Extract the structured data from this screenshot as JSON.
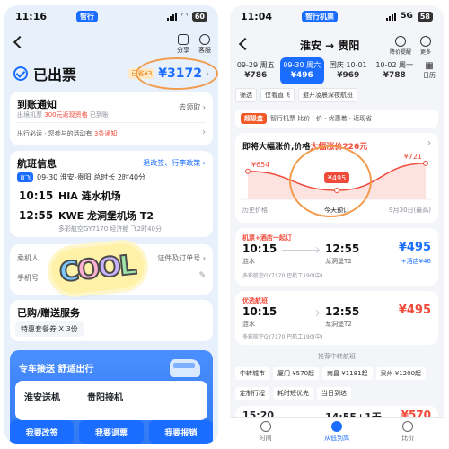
{
  "left": {
    "status": {
      "time": "11:16",
      "pill": "智行",
      "battery": "60"
    },
    "toolbar": {
      "share": "分享",
      "service": "客服"
    },
    "issued": {
      "label": "已出票",
      "saved": "已省¥3",
      "price": "¥3172"
    },
    "arrival": {
      "title": "到账通知",
      "desc_prefix": "出境机票",
      "desc_red": "300元返现资格",
      "desc_suffix": "已到账",
      "action": "去领取",
      "activity_prefix": "出行必读 · 您参与的活动有",
      "activity_red": "3条通知"
    },
    "flight": {
      "title": "航班信息",
      "links": "退改签、行李政策",
      "tag": "直飞",
      "summary": "09-30 淮安-贵阳 总时长 2时40分",
      "dep_time": "10:15",
      "dep_airport": "HIA 涟水机场",
      "arr_time": "12:55",
      "arr_airport": "KWE 龙洞堡机场 T2",
      "meta": "多彩航空GY7170  经济舱  飞2时40分"
    },
    "passenger": {
      "label1": "乘机人",
      "label2": "手机号",
      "doc": "证件及订单号"
    },
    "sticker": {
      "letters": [
        "C",
        "O",
        "O",
        "L"
      ]
    },
    "purchase": {
      "title": "已购/赠送服务",
      "chip": "特惠套餐券 X 3份"
    },
    "banner": {
      "title": "专车接送 舒适出行"
    },
    "transfer": {
      "left": "淮安送机",
      "right": "贵阳接机"
    },
    "actions": [
      "我要改签",
      "我要退票",
      "我要报销"
    ]
  },
  "right": {
    "status": {
      "time": "11:04",
      "pill": "智行机票",
      "battery": "58"
    },
    "header": {
      "route": "淮安 → 贵阳",
      "tool1": "降价提醒",
      "tool2": "更多"
    },
    "dates": [
      {
        "d": "09-29 周五",
        "p": "¥786",
        "active": false
      },
      {
        "d": "09-30 周六",
        "p": "¥496",
        "active": true
      },
      {
        "d": "国庆 10-01",
        "p": "¥969",
        "active": false
      },
      {
        "d": "10-02 周一",
        "p": "¥788",
        "active": false
      }
    ],
    "calendar": "日历",
    "filters": [
      "筛选",
      "仅看直飞",
      "避开凌晨深夜航班"
    ],
    "promo": {
      "logo": "超级盒",
      "text": "智行机票 比价 · 价 · 优惠着 · 返现省"
    },
    "trend": {
      "title_prefix": "即将大幅涨价,价格",
      "title_red": "大幅涨价226元"
    },
    "flights": [
      {
        "tag": "机票+酒店一起订",
        "dep": "10:15",
        "dep_air": "涟水",
        "arr": "12:55",
        "arr_air": "龙洞堡T2",
        "price": "¥495",
        "sub": "+酒店¥46",
        "meta": "多彩航空GY7170  巴航工190(中)"
      },
      {
        "tag": "优选航班",
        "dep": "10:15",
        "dep_air": "涟水",
        "arr": "12:55",
        "arr_air": "龙洞堡T2",
        "price": "¥495",
        "sub": "",
        "meta": "多彩航空GY7170  巴航工190(中)"
      }
    ],
    "recommend_label": "推荐中转航班",
    "transfers": [
      "中转城市",
      "厦门 ¥570起",
      "南昌 ¥1181起",
      "泉州 ¥1200起"
    ],
    "times_row": [
      "定制行程",
      "耗时短优先",
      "当日到达"
    ],
    "peek": {
      "dep": "15:20",
      "arr": "14:55+1天",
      "price": "¥570"
    },
    "nav": [
      "时间",
      "从低到高",
      "比价"
    ]
  },
  "chart_data": {
    "type": "line",
    "title": "即将大幅涨价,价格大幅涨价226元",
    "categories": [
      "历史价格",
      "今天预订",
      "9月30日(最高)"
    ],
    "values": [
      654,
      495,
      721
    ],
    "xlabel": "",
    "ylabel": "",
    "tick_labels": [
      "历史价格",
      "今天预订",
      "9月30日(最高)"
    ],
    "data_labels": [
      "¥654",
      "¥495",
      "¥721"
    ],
    "ylim": [
      450,
      750
    ]
  }
}
